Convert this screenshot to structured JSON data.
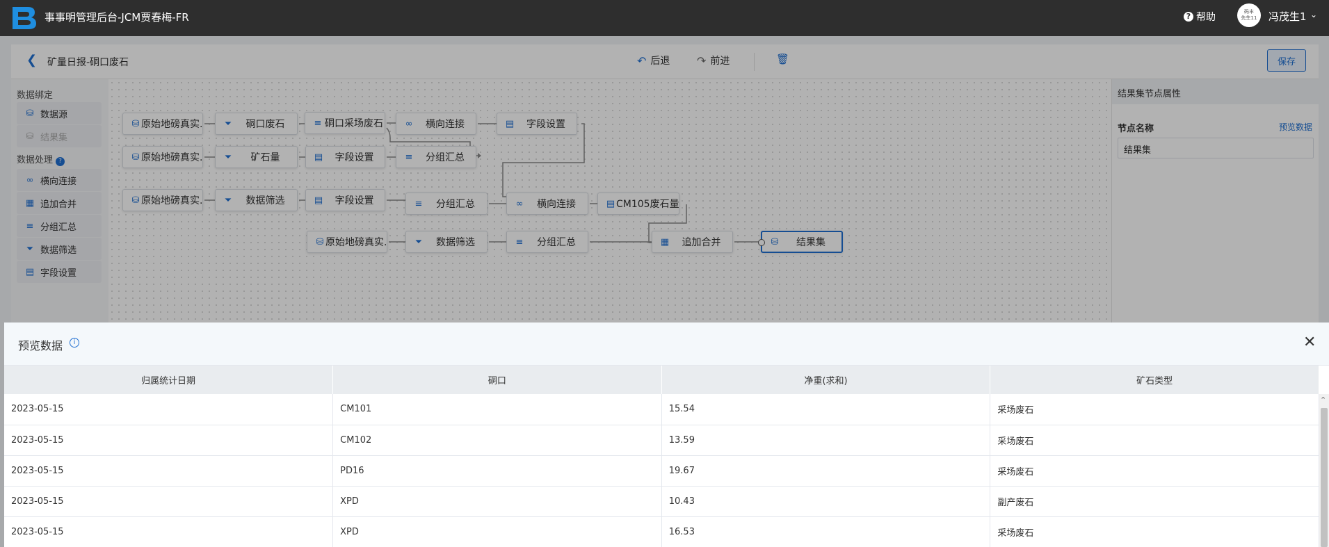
{
  "header": {
    "app_title": "事事明管理后台-JCM贾春梅-FR",
    "help_label": "帮助",
    "avatar_text": "码丰\n先生11",
    "user_name": "冯茂生1"
  },
  "toolbar": {
    "flow_title": "矿量日报-硐口废石",
    "undo_label": "后退",
    "redo_label": "前进",
    "save_label": "保存"
  },
  "sidebar": {
    "binding_title": "数据绑定",
    "binding_items": [
      {
        "label": "数据源",
        "icon": "database-icon"
      },
      {
        "label": "结果集",
        "icon": "result-set-icon"
      }
    ],
    "processing_title": "数据处理",
    "processing_items": [
      {
        "label": "横向连接",
        "icon": "join-icon"
      },
      {
        "label": "追加合并",
        "icon": "append-icon"
      },
      {
        "label": "分组汇总",
        "icon": "group-icon"
      },
      {
        "label": "数据筛选",
        "icon": "filter-icon"
      },
      {
        "label": "字段设置",
        "icon": "field-settings-icon"
      }
    ]
  },
  "flow": {
    "nodes": [
      {
        "label": "原始地磅真实...",
        "icon": "database-icon"
      },
      {
        "label": "硐口废石",
        "icon": "filter-icon"
      },
      {
        "label": "硐口采场废石",
        "icon": "group-icon"
      },
      {
        "label": "横向连接",
        "icon": "join-icon"
      },
      {
        "label": "字段设置",
        "icon": "field-settings-icon"
      },
      {
        "label": "原始地磅真实...",
        "icon": "database-icon"
      },
      {
        "label": "矿石量",
        "icon": "filter-icon"
      },
      {
        "label": "字段设置",
        "icon": "field-settings-icon"
      },
      {
        "label": "分组汇总",
        "icon": "group-icon"
      },
      {
        "label": "原始地磅真实...",
        "icon": "database-icon"
      },
      {
        "label": "数据筛选",
        "icon": "filter-icon"
      },
      {
        "label": "字段设置",
        "icon": "field-settings-icon"
      },
      {
        "label": "分组汇总",
        "icon": "group-icon"
      },
      {
        "label": "横向连接",
        "icon": "join-icon"
      },
      {
        "label": "CM105废石量",
        "icon": "field-settings-icon"
      },
      {
        "label": "原始地磅真实...",
        "icon": "database-icon"
      },
      {
        "label": "数据筛选",
        "icon": "filter-icon"
      },
      {
        "label": "分组汇总",
        "icon": "group-icon"
      },
      {
        "label": "追加合并",
        "icon": "append-icon"
      },
      {
        "label": "结果集",
        "icon": "result-set-icon"
      }
    ]
  },
  "properties": {
    "title": "结果集节点属性",
    "name_label": "节点名称",
    "preview_link": "预览数据",
    "name_value": "结果集"
  },
  "preview": {
    "title": "预览数据",
    "columns": [
      "归属统计日期",
      "硐口",
      "净重(求和)",
      "矿石类型"
    ],
    "rows": [
      [
        "2023-05-15",
        "CM101",
        "15.54",
        "采场废石"
      ],
      [
        "2023-05-15",
        "CM102",
        "13.59",
        "采场废石"
      ],
      [
        "2023-05-15",
        "PD16",
        "19.67",
        "采场废石"
      ],
      [
        "2023-05-15",
        "XPD",
        "10.43",
        "副产废石"
      ],
      [
        "2023-05-15",
        "XPD",
        "16.53",
        "采场废石"
      ]
    ]
  },
  "colors": {
    "accent": "#1f6fd1",
    "topbar": "#2e2e2e"
  }
}
